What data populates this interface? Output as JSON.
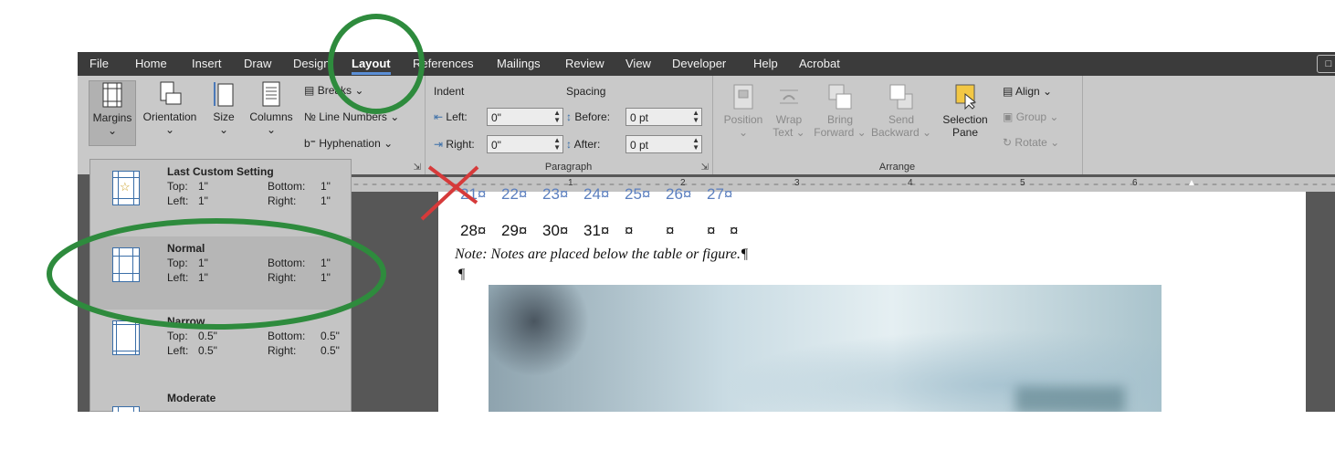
{
  "tabs": [
    "File",
    "Home",
    "Insert",
    "Draw",
    "Design",
    "Layout",
    "References",
    "Mailings",
    "Review",
    "View",
    "Developer",
    "Help",
    "Acrobat"
  ],
  "active_tab": "Layout",
  "page_setup": {
    "margins": "Margins",
    "orientation": "Orientation",
    "size": "Size",
    "columns": "Columns",
    "breaks": "Breaks",
    "line_numbers": "Line Numbers",
    "hyphenation": "Hyphenation"
  },
  "paragraph": {
    "indent_title": "Indent",
    "spacing_title": "Spacing",
    "left_label": "Left:",
    "left_value": "0\"",
    "right_label": "Right:",
    "right_value": "0\"",
    "before_label": "Before:",
    "before_value": "0 pt",
    "after_label": "After:",
    "after_value": "0 pt",
    "group_label": "Paragraph"
  },
  "arrange": {
    "position": "Position",
    "wrap_text": [
      "Wrap",
      "Text"
    ],
    "bring_forward": [
      "Bring",
      "Forward"
    ],
    "send_backward": [
      "Send",
      "Backward"
    ],
    "selection_pane": [
      "Selection",
      "Pane"
    ],
    "align": "Align",
    "group": "Group",
    "rotate": "Rotate",
    "group_label": "Arrange"
  },
  "ruler_numbers": [
    "1",
    "2",
    "3",
    "4",
    "5",
    "6"
  ],
  "margin_options": [
    {
      "title": "Last Custom Setting",
      "top": "1\"",
      "bottom": "1\"",
      "left": "1\"",
      "right": "1\""
    },
    {
      "title": "Normal",
      "top": "1\"",
      "bottom": "1\"",
      "left": "1\"",
      "right": "1\""
    },
    {
      "title": "Narrow",
      "top": "0.5\"",
      "bottom": "0.5\"",
      "left": "0.5\"",
      "right": "0.5\""
    },
    {
      "title": "Moderate"
    }
  ],
  "option_labels": {
    "top": "Top:",
    "bottom": "Bottom:",
    "left": "Left:",
    "right": "Right:"
  },
  "document": {
    "calendar_top": [
      "21¤",
      "22¤",
      "23¤",
      "24¤",
      "25¤",
      "26¤",
      "27¤"
    ],
    "calendar_row": [
      "28¤",
      "29¤",
      "30¤",
      "31¤",
      "¤",
      "¤",
      "¤",
      "¤"
    ],
    "note": "Note: Notes are placed below the table or figure.¶",
    "pilcrow": "¶"
  },
  "colors": {
    "annotation_green": "#2e8b3d",
    "annotation_red": "#d63a3a",
    "accent": "#5b8fd6"
  }
}
